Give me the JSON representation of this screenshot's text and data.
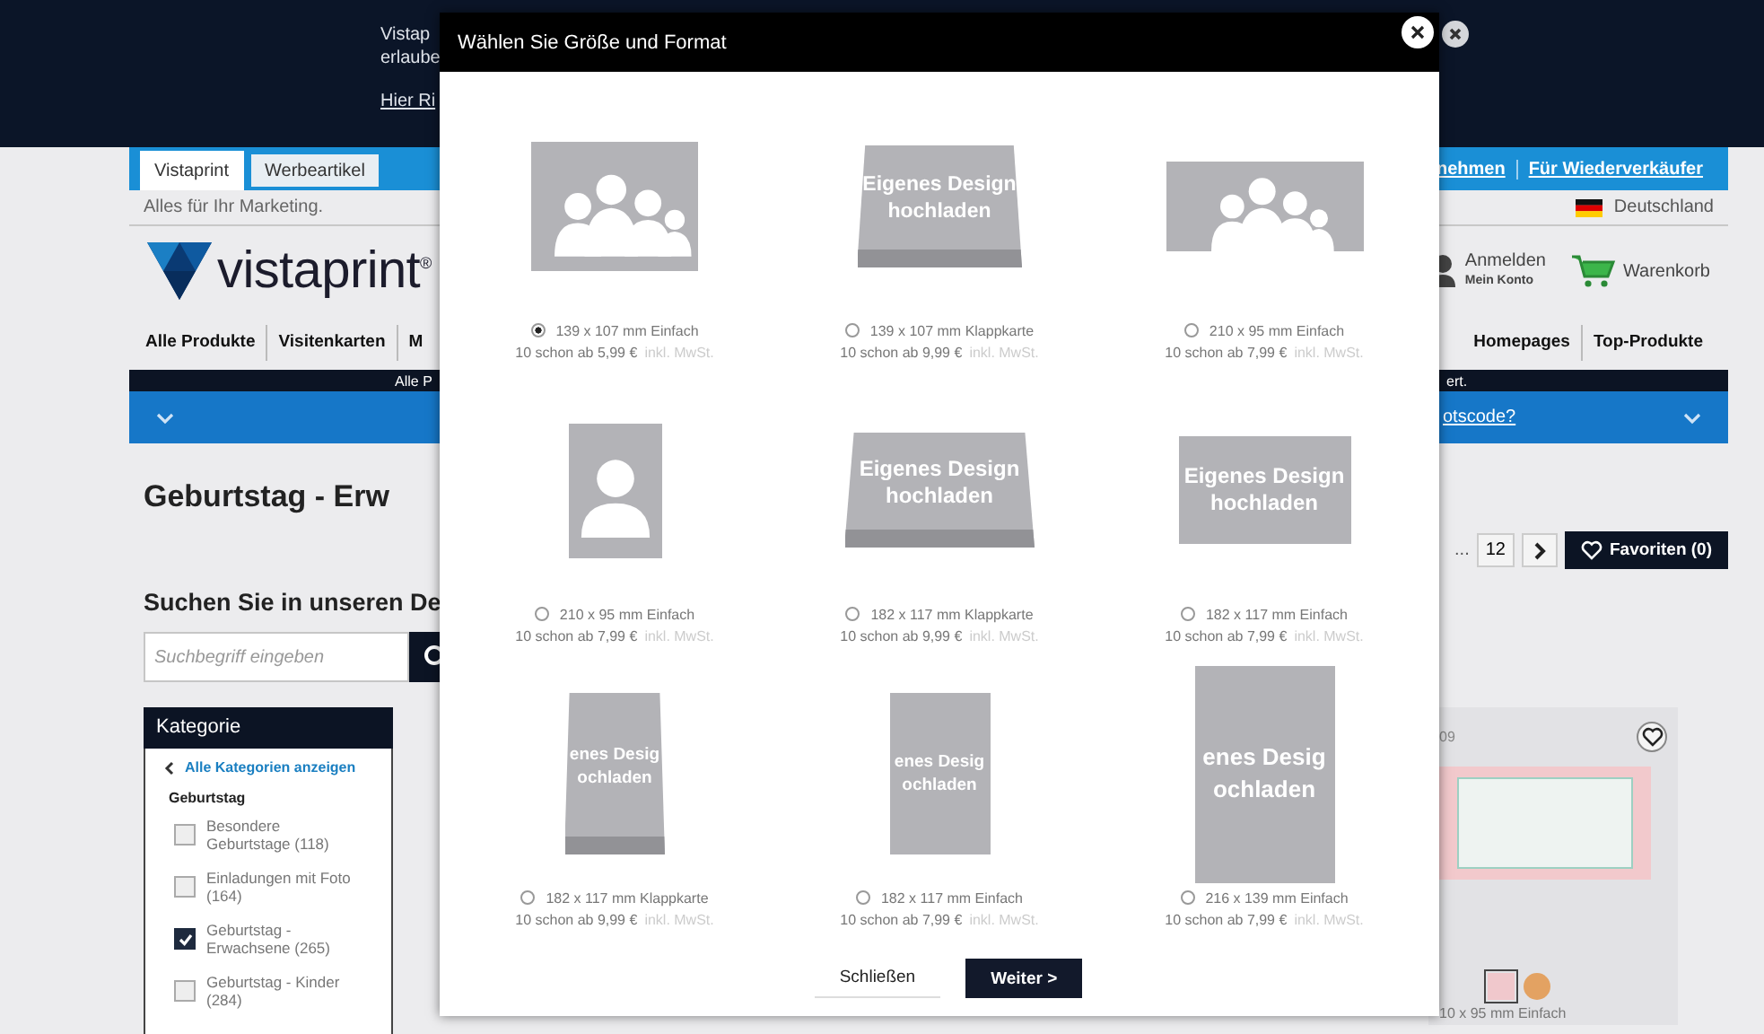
{
  "page": {
    "banner": {
      "notice_lines": [
        "Vistap",
        "erlaube"
      ],
      "link": "Hier Ri"
    },
    "top_tabs": [
      {
        "label": "Vistaprint",
        "selected": true
      },
      {
        "label": "Werbeartikel",
        "selected": false
      }
    ],
    "top_links": [
      "nehmen",
      "Für Wiederverkäufer"
    ],
    "tagline": "Alles für Ihr Marketing.",
    "country": "Deutschland",
    "logo": "vistaprint$^{®}$",
    "account": {
      "label": "Anmelden",
      "sublabel": "Mein Konto"
    },
    "cart": "Warenkorb",
    "nav_left": [
      "Alle Produkte",
      "Visitenkarten",
      "M"
    ],
    "nav_right": [
      "Homepages",
      "Top-Produkte"
    ],
    "promo_strip": [
      "Alle P",
      "ert."
    ],
    "promo_link": "otscode?",
    "heading": "Geburtstag - Erw",
    "pagination": {
      "ellipsis": "...",
      "last_page": "12"
    },
    "favorites_button": "Favoriten (0)",
    "search_heading": "Suchen Sie in unseren De",
    "search": {
      "placeholder": "Suchbegriff eingeben"
    },
    "category_panel": {
      "title": "Kategorie",
      "back_link": "Alle Kategorien anzeigen",
      "group": "Geburtstag",
      "filters": [
        {
          "label": "Besondere Geburtstage (118)",
          "checked": false
        },
        {
          "label": "Einladungen mit Foto (164)",
          "checked": false
        },
        {
          "label": "Geburtstag - Erwachsene (265)",
          "checked": true
        },
        {
          "label": "Geburtstag - Kinder (284)",
          "checked": false
        }
      ]
    },
    "product_card": {
      "text": "09",
      "favorite": false,
      "swatches": [
        {
          "color": "#f0c8cc",
          "selected": true
        },
        {
          "color": "#e3a262",
          "selected": false
        }
      ],
      "size": "10 x 95 mm Einfach"
    }
  },
  "dialog": {
    "title": "Wählen Sie Größe und Format",
    "options": [
      {
        "kind": "landscape-photo",
        "folded": false,
        "size": "139 x 107 mm Einfach",
        "price": "10 schon ab 5,99 €",
        "tax_note": "inkl. MwSt.",
        "selected": true
      },
      {
        "kind": "landscape-design",
        "folded": true,
        "preview_lines": [
          "Eigenes Design",
          "hochladen"
        ],
        "size": "139 x 107 mm Klappkarte",
        "price": "10 schon ab 9,99 €",
        "tax_note": "inkl. MwSt.",
        "selected": false
      },
      {
        "kind": "wide-photo",
        "folded": false,
        "size": "210 x 95 mm Einfach",
        "price": "10 schon ab 7,99 €",
        "tax_note": "inkl. MwSt.",
        "selected": false
      },
      {
        "kind": "portrait-photo",
        "folded": false,
        "size": "210 x 95 mm Einfach",
        "price": "10 schon ab 7,99 €",
        "tax_note": "inkl. MwSt.",
        "selected": false
      },
      {
        "kind": "medium-design",
        "folded": true,
        "preview_lines": [
          "Eigenes Design",
          "hochladen"
        ],
        "size": "182 x 117 mm Klappkarte",
        "price": "10 schon ab 9,99 €",
        "tax_note": "inkl. MwSt.",
        "selected": false
      },
      {
        "kind": "medium-design",
        "folded": false,
        "preview_lines": [
          "Eigenes Design",
          "hochladen"
        ],
        "size": "182 x 117 mm Einfach",
        "price": "10 schon ab 7,99 €",
        "tax_note": "inkl. MwSt.",
        "selected": false
      },
      {
        "kind": "upright-design",
        "folded": true,
        "preview_lines": [
          "enes Desig",
          "ochladen"
        ],
        "size": "182 x 117 mm Klappkarte",
        "price": "10 schon ab 9,99 €",
        "tax_note": "inkl. MwSt.",
        "selected": false
      },
      {
        "kind": "upright-design",
        "folded": false,
        "preview_lines": [
          "enes Desig",
          "ochladen"
        ],
        "size": "182 x 117 mm Einfach",
        "price": "10 schon ab 7,99 €",
        "tax_note": "inkl. MwSt.",
        "selected": false
      },
      {
        "kind": "tall-design",
        "folded": false,
        "preview_lines": [
          "enes Desig",
          "ochladen"
        ],
        "size": "216 x 139 mm Einfach",
        "price": "10 schon ab 7,99 €",
        "tax_note": "inkl. MwSt.",
        "selected": false
      }
    ],
    "buttons": [
      {
        "kind": "secondary",
        "label": "Schließen"
      },
      {
        "kind": "primary",
        "label": "Weiter >"
      }
    ]
  }
}
